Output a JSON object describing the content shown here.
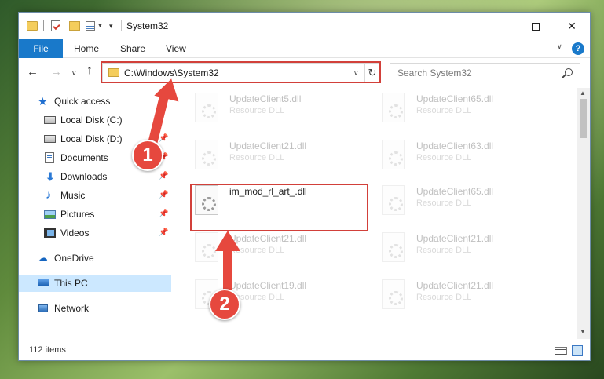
{
  "window": {
    "title": "System32",
    "controls": {
      "minimize": "",
      "maximize": "",
      "close": "✕"
    }
  },
  "ribbon": {
    "tabs": [
      "File",
      "Home",
      "Share",
      "View"
    ],
    "help": "?",
    "expand": "∨"
  },
  "address_bar": {
    "path": "C:\\Windows\\System32",
    "refresh": "↻",
    "dropdown": "∨"
  },
  "search": {
    "placeholder": "Search System32"
  },
  "nav_buttons": {
    "back": "←",
    "forward": "→",
    "recent": "∨",
    "up": "↑"
  },
  "sidebar": {
    "items": [
      {
        "label": "Quick access",
        "icon": "star-icon",
        "pinned": false
      },
      {
        "label": "Local Disk (C:)",
        "icon": "drive-icon",
        "pinned": false
      },
      {
        "label": "Local Disk (D:)",
        "icon": "drive-icon",
        "pinned": true
      },
      {
        "label": "Documents",
        "icon": "documents-icon",
        "pinned": true
      },
      {
        "label": "Downloads",
        "icon": "download-icon",
        "pinned": true
      },
      {
        "label": "Music",
        "icon": "music-icon",
        "pinned": true
      },
      {
        "label": "Pictures",
        "icon": "pictures-icon",
        "pinned": true
      },
      {
        "label": "Videos",
        "icon": "videos-icon",
        "pinned": true
      },
      {
        "label": "OneDrive",
        "icon": "onedrive-icon",
        "pinned": false
      },
      {
        "label": "This PC",
        "icon": "this-pc-icon",
        "pinned": false,
        "selected": true
      },
      {
        "label": "Network",
        "icon": "network-icon",
        "pinned": false
      }
    ],
    "pin_glyph": "📌"
  },
  "files": [
    {
      "name": "UpdateClient5.dll",
      "type": "Resource DLL",
      "faded": true
    },
    {
      "name": "UpdateClient65.dll",
      "type": "Resource DLL",
      "faded": true
    },
    {
      "name": "UpdateClient21.dll",
      "type": "Resource DLL",
      "faded": true
    },
    {
      "name": "UpdateClient63.dll",
      "type": "Resource DLL",
      "faded": true
    },
    {
      "name": "im_mod_rl_art_.dll",
      "type": "",
      "faded": false
    },
    {
      "name": "UpdateClient65.dll",
      "type": "Resource DLL",
      "faded": true
    },
    {
      "name": "UpdateClient21.dll",
      "type": "Resource DLL",
      "faded": true
    },
    {
      "name": "UpdateClient21.dll",
      "type": "Resource DLL",
      "faded": true
    },
    {
      "name": "UpdateClient19.dll",
      "type": "Resource DLL",
      "faded": true
    },
    {
      "name": "UpdateClient21.dll",
      "type": "Resource DLL",
      "faded": true
    }
  ],
  "status": {
    "item_count": "112 items"
  },
  "annotations": {
    "step1": "1",
    "step2": "2",
    "color": "#e6483e"
  },
  "colors": {
    "accent": "#1979ca",
    "selection": "#cce8ff",
    "highlight": "#d2403a"
  }
}
